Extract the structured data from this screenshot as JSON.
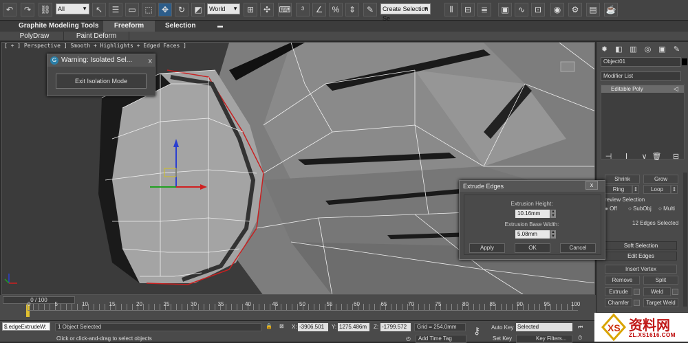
{
  "toolbar": {
    "filter_value": "All",
    "coord_system": "World",
    "selection_set_placeholder": "Create Selection Se",
    "icons": [
      "undo-icon",
      "redo-icon",
      "select-link-icon",
      "unlink-icon",
      "bind-spacewarp-icon",
      "select-icon",
      "select-by-name-icon",
      "rect-region-icon",
      "window-crossing-icon",
      "move-icon",
      "rotate-icon",
      "scale-icon",
      "use-pivot-icon",
      "select-manipulate-icon",
      "keyboard-shortcut-icon",
      "snap-3d-icon",
      "angle-snap-icon",
      "percent-snap-icon",
      "spinner-snap-icon",
      "edit-named-sel-icon",
      "mirror-icon",
      "align-icon",
      "layer-manager-icon",
      "graphite-icon",
      "curve-editor-icon",
      "schematic-icon",
      "material-editor-icon",
      "render-setup-icon",
      "render-frame-icon",
      "render-icon"
    ]
  },
  "ribbon": {
    "tabs": [
      "Graphite Modeling Tools",
      "Freeform",
      "Selection"
    ],
    "subtabs": [
      "PolyDraw",
      "Paint Deform"
    ]
  },
  "viewport": {
    "label": "[ + ] Perspective ] Smooth + Highlights + Edged Faces ]"
  },
  "warning_dialog": {
    "title": "Warning: Isolated Sel...",
    "close": "x",
    "button": "Exit Isolation Mode"
  },
  "extrude_dialog": {
    "title": "Extrude Edges",
    "close": "x",
    "height_label": "Extrusion Height:",
    "height_value": "10.16mm",
    "base_label": "Extrusion Base Width:",
    "base_value": "5.08mm",
    "apply": "Apply",
    "ok": "OK",
    "cancel": "Cancel"
  },
  "command_panel": {
    "object_name": "Object01",
    "modifier_list": "Modifier List",
    "stack_item": "Editable Poly",
    "shrink": "Shrink",
    "grow": "Grow",
    "ring": "Ring",
    "loop": "Loop",
    "preview_label": "review Selection",
    "preview_off": "Off",
    "preview_subobj": "SubObj",
    "preview_multi": "Multi",
    "selected_info": "12 Edges Selected",
    "soft_selection": "Soft Selection",
    "edit_edges": "Edit Edges",
    "insert_vertex": "Insert Vertex",
    "remove": "Remove",
    "split": "Split",
    "extrude": "Extrude",
    "weld": "Weld",
    "chamfer": "Chamfer",
    "target_weld": "Target Weld"
  },
  "timeline": {
    "slider": "0 / 100",
    "ticks": [
      "0",
      "5",
      "10",
      "15",
      "20",
      "25",
      "30",
      "35",
      "40",
      "45",
      "50",
      "55",
      "60",
      "65",
      "70",
      "75",
      "80",
      "85",
      "90",
      "95",
      "100"
    ]
  },
  "status": {
    "script_listener": "$.edgeExtrudeW:",
    "selected": "1 Object Selected",
    "prompt": "Click or click-and-drag to select objects",
    "x_label": "X:",
    "x_value": "-3906.501",
    "y_label": "Y:",
    "y_value": "1275.486m",
    "z_label": "Z:",
    "z_value": "-1799.572",
    "grid": "Grid = 254.0mm",
    "add_time_tag": "Add Time Tag",
    "auto_key": "Auto Key",
    "set_key": "Set Key",
    "key_mode": "Selected",
    "key_filters": "Key Filters..."
  },
  "watermark": {
    "text": "资料网",
    "url": "ZL.XS1616.COM"
  }
}
